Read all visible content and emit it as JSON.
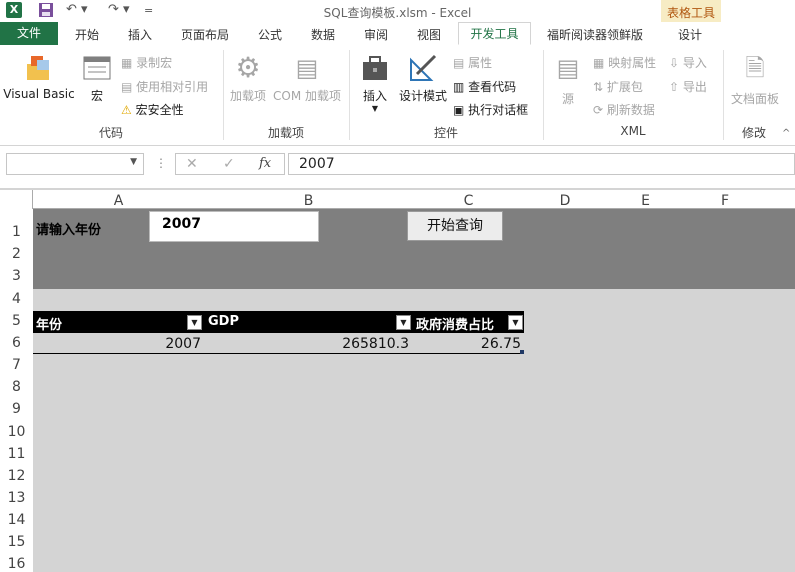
{
  "window": {
    "title": "SQL查询模板.xlsm - Excel",
    "logo_letter": "X",
    "context_group": "表格工具"
  },
  "tabs": [
    "文件",
    "开始",
    "插入",
    "页面布局",
    "公式",
    "数据",
    "审阅",
    "视图",
    "开发工具",
    "福昕阅读器领鲜版",
    "设计"
  ],
  "active_tab": "开发工具",
  "ribbon": {
    "code": {
      "label": "代码",
      "visual_basic": "Visual Basic",
      "macros": "宏",
      "record_macro": "录制宏",
      "relative_ref": "使用相对引用",
      "macro_security": "宏安全性"
    },
    "addins": {
      "label": "加载项",
      "addins": "加载项",
      "com_addins": "COM 加载项"
    },
    "controls": {
      "label": "控件",
      "insert": "插入",
      "design_mode": "设计模式",
      "properties": "属性",
      "view_code": "查看代码",
      "run_dialog": "执行对话框"
    },
    "xml": {
      "label": "XML",
      "source": "源",
      "map_props": "映射属性",
      "expansion": "扩展包",
      "refresh": "刷新数据",
      "import": "导入",
      "export": "导出"
    },
    "modify": {
      "label": "修改",
      "doc_panel": "文档面板"
    }
  },
  "formula_bar": {
    "name_box": "",
    "fx": "fx",
    "value": "2007"
  },
  "columns": [
    "A",
    "B",
    "C",
    "D",
    "E",
    "F"
  ],
  "rows": [
    "1",
    "2",
    "3",
    "4",
    "5",
    "6",
    "7",
    "8",
    "9",
    "10",
    "11",
    "12",
    "13",
    "14",
    "15",
    "16"
  ],
  "sheet": {
    "prompt_label": "请输入年份",
    "year_input": "2007",
    "query_button": "开始查询",
    "table": {
      "headers": [
        "年份",
        "GDP",
        "政府消费占比"
      ],
      "rows": [
        [
          "2007",
          "265810.3",
          "26.75"
        ]
      ]
    }
  },
  "colors": {
    "excel_green": "#217346",
    "band_gray": "#7f7f7f",
    "sheet_gray": "#d4d4d4"
  }
}
